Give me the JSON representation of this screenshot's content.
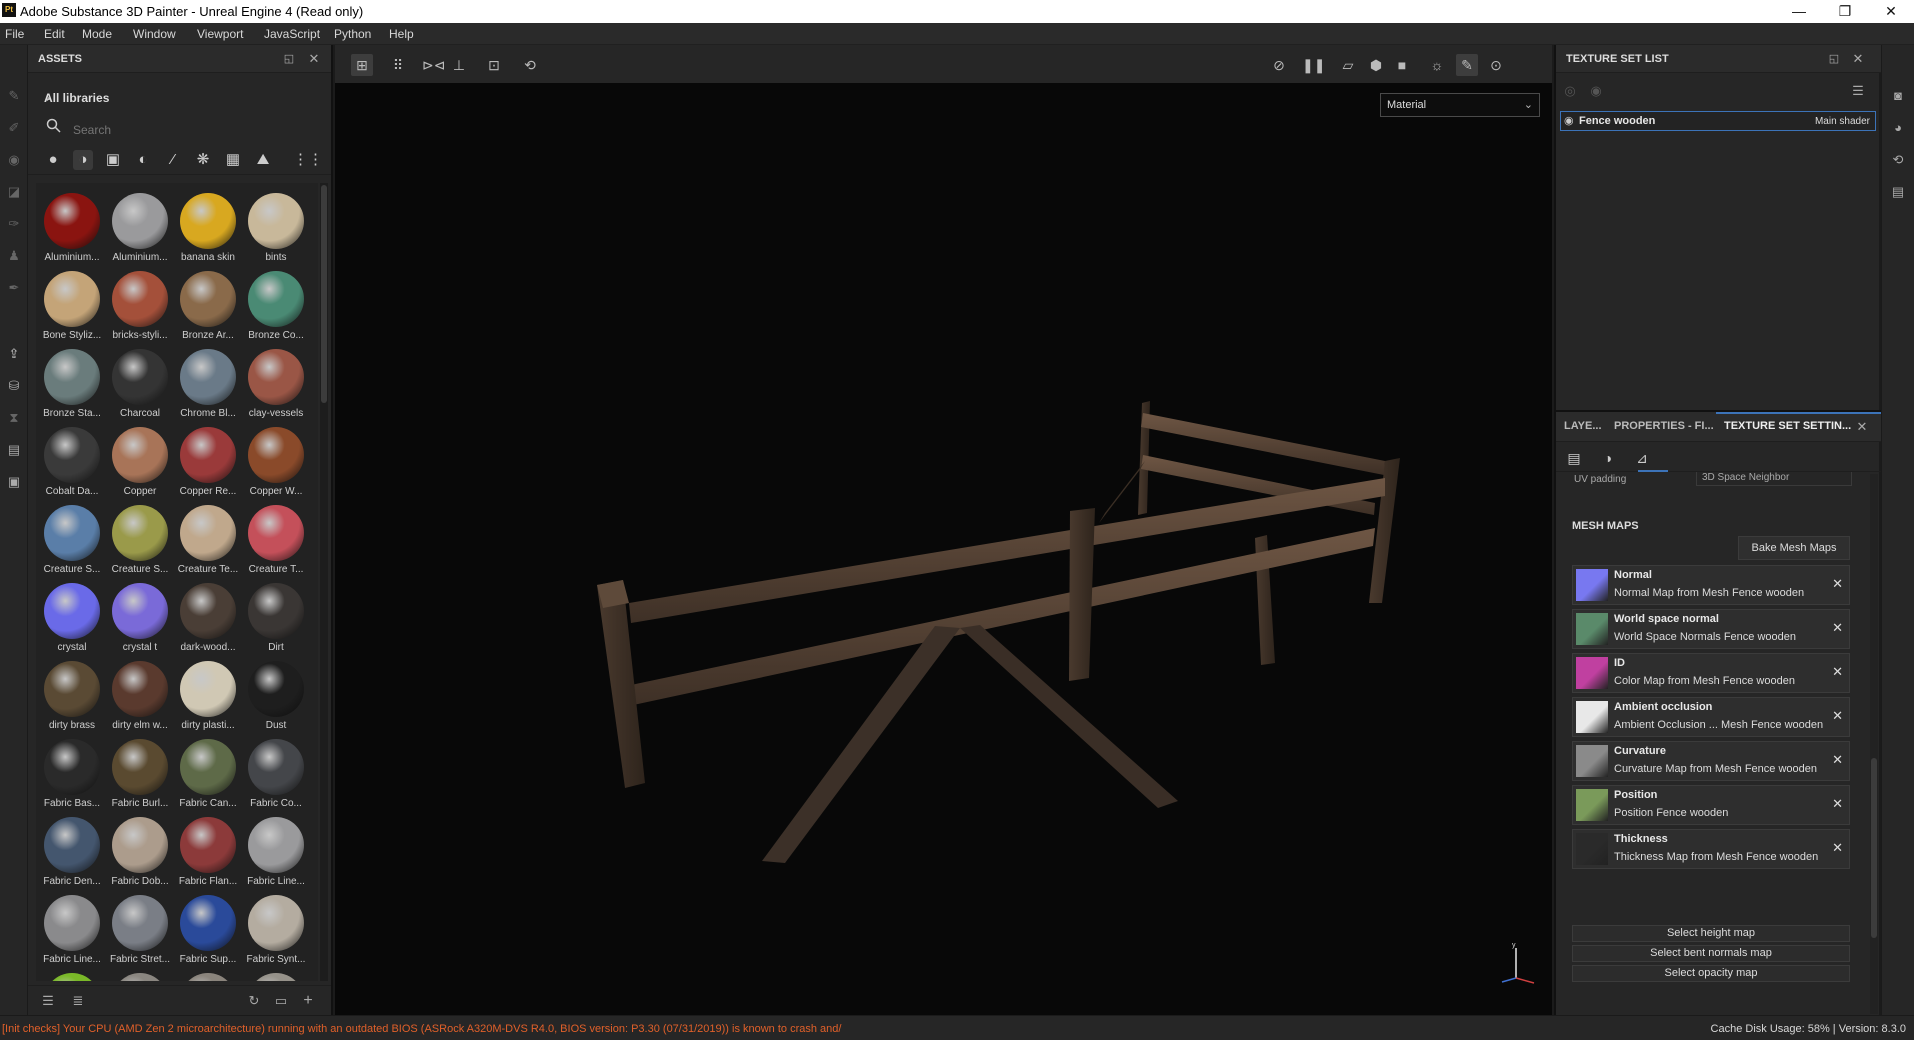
{
  "titlebar": {
    "app_icon": "Pt",
    "title": "Adobe Substance 3D Painter - Unreal Engine 4 (Read only)",
    "minimize": "—",
    "maximize": "❐",
    "close": "✕"
  },
  "menu": [
    "File",
    "Edit",
    "Mode",
    "Window",
    "Viewport",
    "JavaScript",
    "Python",
    "Help"
  ],
  "assets": {
    "title": "ASSETS",
    "library": "All libraries",
    "search_placeholder": "Search",
    "materials": [
      {
        "label": "Aluminium...",
        "color": "#8a1410"
      },
      {
        "label": "Aluminium...",
        "color": "#9a9a9c"
      },
      {
        "label": "banana skin",
        "color": "#d8a820"
      },
      {
        "label": "bints",
        "color": "#c8b89a"
      },
      {
        "label": "Bone Styliz...",
        "color": "#c4a478"
      },
      {
        "label": "bricks-styli...",
        "color": "#a4503a"
      },
      {
        "label": "Bronze Ar...",
        "color": "#8a6a4a"
      },
      {
        "label": "Bronze Co...",
        "color": "#4a8a74"
      },
      {
        "label": "Bronze Sta...",
        "color": "#6a7c7c"
      },
      {
        "label": "Charcoal",
        "color": "#343434"
      },
      {
        "label": "Chrome Bl...",
        "color": "#6a7a88"
      },
      {
        "label": "clay-vessels",
        "color": "#9a5646"
      },
      {
        "label": "Cobalt Da...",
        "color": "#3a3a3a"
      },
      {
        "label": "Copper",
        "color": "#a87458"
      },
      {
        "label": "Copper Re...",
        "color": "#9a3a3a"
      },
      {
        "label": "Copper W...",
        "color": "#8a4a2a"
      },
      {
        "label": "Creature S...",
        "color": "#5a7ea8"
      },
      {
        "label": "Creature S...",
        "color": "#9a9a4a"
      },
      {
        "label": "Creature Te...",
        "color": "#c0a88c"
      },
      {
        "label": "Creature T...",
        "color": "#c4505a"
      },
      {
        "label": "crystal",
        "color": "#6a6ae8"
      },
      {
        "label": "crystal t",
        "color": "#7a6ad8"
      },
      {
        "label": "dark-wood...",
        "color": "#4a3e36"
      },
      {
        "label": "Dirt",
        "color": "#3a3634"
      },
      {
        "label": "dirty brass",
        "color": "#5a4a34"
      },
      {
        "label": "dirty elm w...",
        "color": "#5a3a2e"
      },
      {
        "label": "dirty plasti...",
        "color": "#d0c8b4"
      },
      {
        "label": "Dust",
        "color": "#1e1e1e"
      },
      {
        "label": "Fabric Bas...",
        "color": "#2a2a2a"
      },
      {
        "label": "Fabric Burl...",
        "color": "#5a4a30"
      },
      {
        "label": "Fabric Can...",
        "color": "#5e6a48"
      },
      {
        "label": "Fabric Co...",
        "color": "#44464a"
      },
      {
        "label": "Fabric Den...",
        "color": "#44566e"
      },
      {
        "label": "Fabric Dob...",
        "color": "#ac9c8c"
      },
      {
        "label": "Fabric Flan...",
        "color": "#8c3a3a"
      },
      {
        "label": "Fabric Line...",
        "color": "#9a9a9c"
      },
      {
        "label": "Fabric Line...",
        "color": "#8a8a8c"
      },
      {
        "label": "Fabric Stret...",
        "color": "#7a7e86"
      },
      {
        "label": "Fabric Sup...",
        "color": "#2a4a9a"
      },
      {
        "label": "Fabric Synt...",
        "color": "#b4aca0"
      },
      {
        "label": "",
        "color": "#7ab828"
      },
      {
        "label": "",
        "color": "#8a8680"
      },
      {
        "label": "",
        "color": "#8a847c"
      },
      {
        "label": "",
        "color": "#96928a"
      }
    ]
  },
  "viewport": {
    "material_mode": "Material"
  },
  "texture_set_list": {
    "title": "TEXTURE SET LIST",
    "set_name": "Fence wooden",
    "shader": "Main shader"
  },
  "texture_set_settings": {
    "tabs": [
      "LAYE...",
      "PROPERTIES - FI...",
      "TEXTURE SET SETTIN..."
    ],
    "uv_padding_label": "UV padding",
    "uv_padding_value": "3D Space Neighbor",
    "mesh_maps_title": "MESH MAPS",
    "bake_label": "Bake Mesh Maps",
    "maps": [
      {
        "name": "Normal",
        "desc": "Normal Map from Mesh Fence wooden",
        "color": "#7878f0"
      },
      {
        "name": "World space normal",
        "desc": "World Space Normals Fence wooden",
        "color": "#5a8a6a"
      },
      {
        "name": "ID",
        "desc": "Color Map from Mesh Fence wooden",
        "color": "#c040a0"
      },
      {
        "name": "Ambient occlusion",
        "desc": "Ambient Occlusion ... Mesh Fence wooden",
        "color": "#e8e8e8"
      },
      {
        "name": "Curvature",
        "desc": "Curvature Map from Mesh Fence wooden",
        "color": "#8a8a8a"
      },
      {
        "name": "Position",
        "desc": "Position Fence wooden",
        "color": "#7a9a5a"
      },
      {
        "name": "Thickness",
        "desc": "Thickness Map from Mesh Fence wooden",
        "color": "#2a2a2a"
      }
    ],
    "select_height": "Select height map",
    "select_bent": "Select bent normals map",
    "select_opacity": "Select opacity map"
  },
  "status": {
    "warning": "[Init checks] Your CPU (AMD Zen 2 microarchitecture) running with an outdated BIOS (ASRock A320M-DVS R4.0, BIOS version: P3.30 (07/31/2019)) is known to crash and/or...",
    "cache": "Cache Disk Usage:   58% | Version: 8.3.0"
  }
}
